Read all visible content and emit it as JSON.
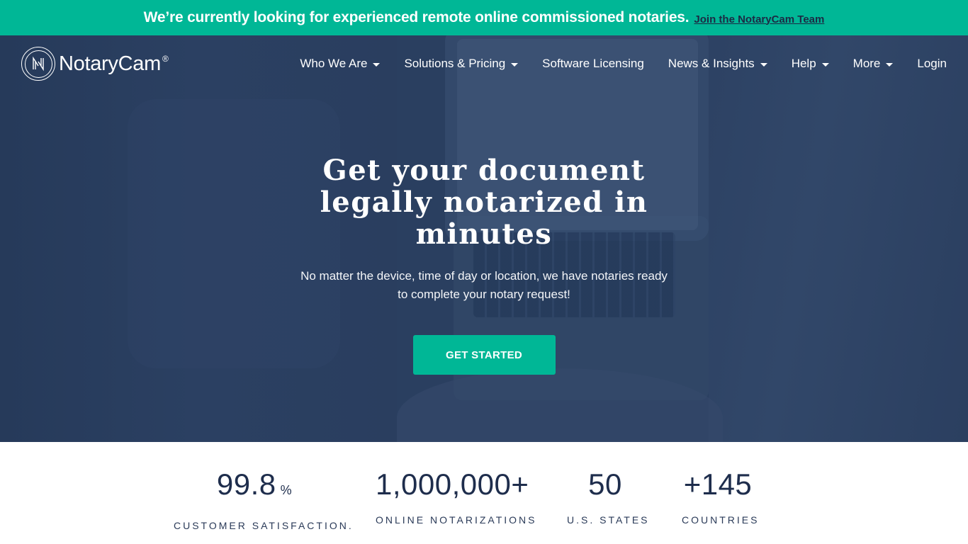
{
  "announcement": {
    "message": "We’re currently looking for experienced remote online commissioned notaries.",
    "link_label": "Join the NotaryCam Team"
  },
  "brand": {
    "name": "NotaryCam",
    "registered_mark": "®",
    "logo_icon": "notarycam-n-circle-icon"
  },
  "nav": {
    "items": [
      {
        "label": "Who We Are",
        "has_dropdown": true
      },
      {
        "label": "Solutions & Pricing",
        "has_dropdown": true
      },
      {
        "label": "Software Licensing",
        "has_dropdown": false
      },
      {
        "label": "News & Insights",
        "has_dropdown": true
      },
      {
        "label": "Help",
        "has_dropdown": true
      },
      {
        "label": "More",
        "has_dropdown": true
      },
      {
        "label": "Login",
        "has_dropdown": false
      }
    ]
  },
  "hero": {
    "headline": "Get your document legally notarized in minutes",
    "subheadline": "No matter the device, time of day or location, we have notaries ready to complete your notary request!",
    "cta_label": "GET STARTED"
  },
  "stats": [
    {
      "value": "99.8",
      "suffix": "%",
      "label": "CUSTOMER SATISFACTION."
    },
    {
      "value": "1,000,000+",
      "suffix": "",
      "label": "ONLINE NOTARIZATIONS"
    },
    {
      "value": "50",
      "suffix": "",
      "label": "U.S. STATES"
    },
    {
      "value": "+145",
      "suffix": "",
      "label": "COUNTRIES"
    }
  ],
  "colors": {
    "accent": "#00b796",
    "hero_overlay": "#2a3f60",
    "stat_text": "#1e2d4c",
    "announcement_link": "#1c2a44"
  }
}
